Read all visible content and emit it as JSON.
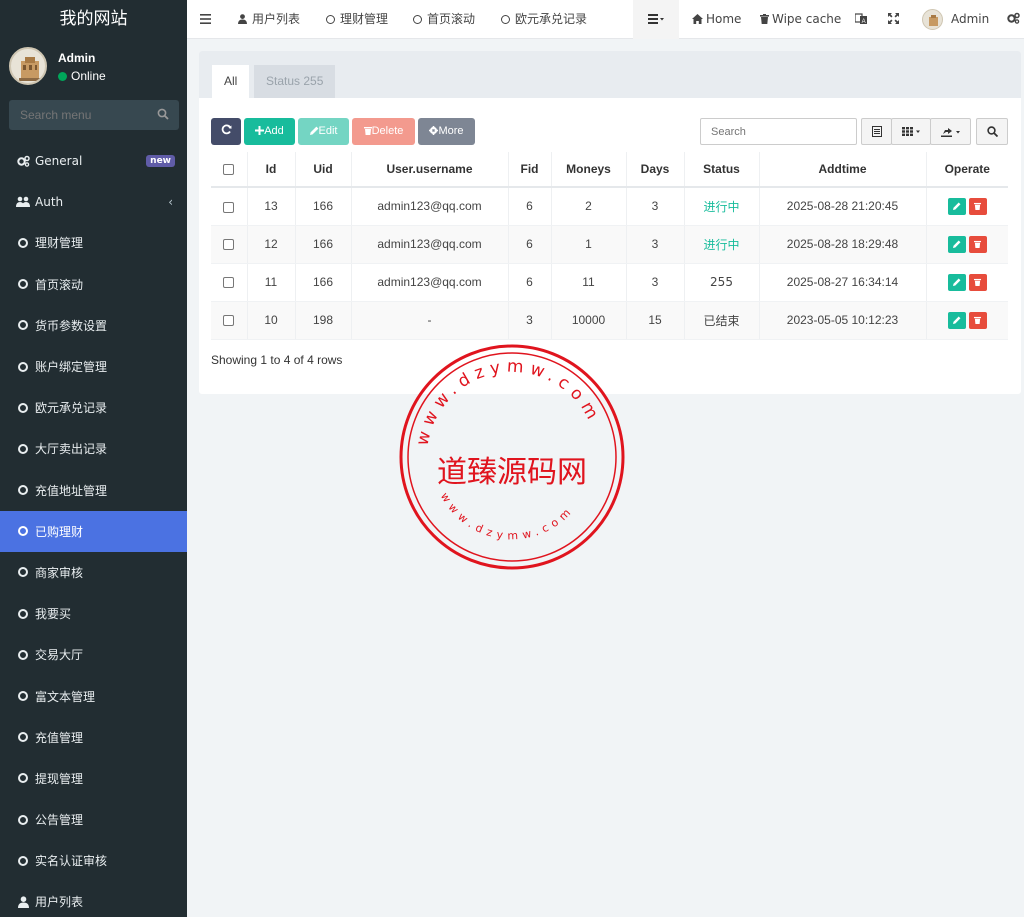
{
  "sidebar": {
    "title": "我的网站",
    "user": {
      "name": "Admin",
      "status": "Online"
    },
    "search_placeholder": "Search menu",
    "items": [
      {
        "label": "General",
        "icon": "cogs-icon",
        "badge": "new"
      },
      {
        "label": "Auth",
        "icon": "users-icon",
        "chevron": "‹"
      },
      {
        "label": "理财管理",
        "icon": "circle-icon"
      },
      {
        "label": "首页滚动",
        "icon": "circle-icon"
      },
      {
        "label": "货币参数设置",
        "icon": "circle-icon"
      },
      {
        "label": "账户绑定管理",
        "icon": "circle-icon"
      },
      {
        "label": "欧元承兑记录",
        "icon": "circle-icon"
      },
      {
        "label": "大厅卖出记录",
        "icon": "circle-icon"
      },
      {
        "label": "充值地址管理",
        "icon": "circle-icon"
      },
      {
        "label": "已购理财",
        "icon": "circle-icon",
        "active": true
      },
      {
        "label": "商家审核",
        "icon": "circle-icon"
      },
      {
        "label": "我要买",
        "icon": "circle-icon"
      },
      {
        "label": "交易大厅",
        "icon": "circle-icon"
      },
      {
        "label": "富文本管理",
        "icon": "circle-icon"
      },
      {
        "label": "充值管理",
        "icon": "circle-icon"
      },
      {
        "label": "提现管理",
        "icon": "circle-icon"
      },
      {
        "label": "公告管理",
        "icon": "circle-icon"
      },
      {
        "label": "实名认证审核",
        "icon": "circle-icon"
      },
      {
        "label": "用户列表",
        "icon": "user-icon"
      }
    ]
  },
  "topnav": {
    "tabs": [
      "用户列表",
      "理财管理",
      "首页滚动",
      "欧元承兑记录"
    ],
    "home": "Home",
    "wipe_cache": "Wipe cache",
    "admin": "Admin"
  },
  "panel": {
    "tabs": [
      "All",
      "Status 255"
    ],
    "toolbar": {
      "add": "Add",
      "edit": "Edit",
      "delete": "Delete",
      "more": "More"
    },
    "search_placeholder": "Search",
    "columns": [
      "Id",
      "Uid",
      "User.username",
      "Fid",
      "Moneys",
      "Days",
      "Status",
      "Addtime",
      "Operate"
    ],
    "rows": [
      {
        "id": "13",
        "uid": "166",
        "username": "admin123@qq.com",
        "fid": "6",
        "moneys": "2",
        "days": "3",
        "status": "进行中",
        "addtime": "2025-08-28 21:20:45"
      },
      {
        "id": "12",
        "uid": "166",
        "username": "admin123@qq.com",
        "fid": "6",
        "moneys": "1",
        "days": "3",
        "status": "进行中",
        "addtime": "2025-08-28 18:29:48"
      },
      {
        "id": "11",
        "uid": "166",
        "username": "admin123@qq.com",
        "fid": "6",
        "moneys": "11",
        "days": "3",
        "status": "255",
        "addtime": "2025-08-27 16:34:14"
      },
      {
        "id": "10",
        "uid": "198",
        "username": "-",
        "fid": "3",
        "moneys": "10000",
        "days": "15",
        "status": "已结束",
        "addtime": "2023-05-05 10:12:23"
      }
    ],
    "showing": "Showing 1 to 4 of 4 rows"
  },
  "watermark": {
    "center": "道臻源码网",
    "ring_top": "www.dzymw.com",
    "ring_bottom": "www.dzymw.com"
  },
  "colors": {
    "sidebar_bg": "#222d32",
    "active_item": "#4b72e2",
    "success": "#18bc9c",
    "danger": "#e74c3c",
    "seal": "#e0141e"
  }
}
